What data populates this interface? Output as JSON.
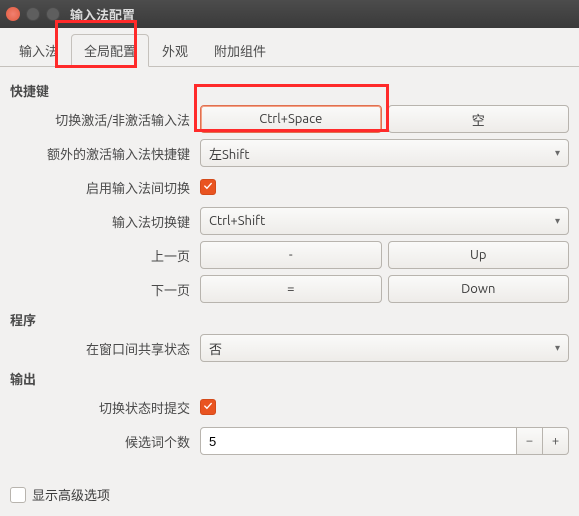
{
  "window": {
    "title": "输入法配置"
  },
  "tabs": {
    "t1": "输入法",
    "t2": "全局配置",
    "t3": "外观",
    "t4": "附加组件"
  },
  "sections": {
    "hotkey": "快捷键",
    "program": "程序",
    "output": "输出"
  },
  "labels": {
    "trigger": "切换激活/非激活输入法",
    "extra": "额外的激活输入法快捷键",
    "enable_switch": "启用输入法间切换",
    "switch_key": "输入法切换键",
    "prev_page": "上一页",
    "next_page": "下一页",
    "share_state": "在窗口间共享状态",
    "commit_switch": "切换状态时提交",
    "candidate_num": "候选词个数",
    "show_advanced": "显示高级选项"
  },
  "values": {
    "trigger_key": "Ctrl+Space",
    "trigger_empty": "空",
    "extra_key": "左Shift",
    "switch_key": "Ctrl+Shift",
    "prev_key": "-",
    "prev_btn": "Up",
    "next_key": "=",
    "next_btn": "Down",
    "share_state": "否",
    "candidate_num": "5"
  }
}
